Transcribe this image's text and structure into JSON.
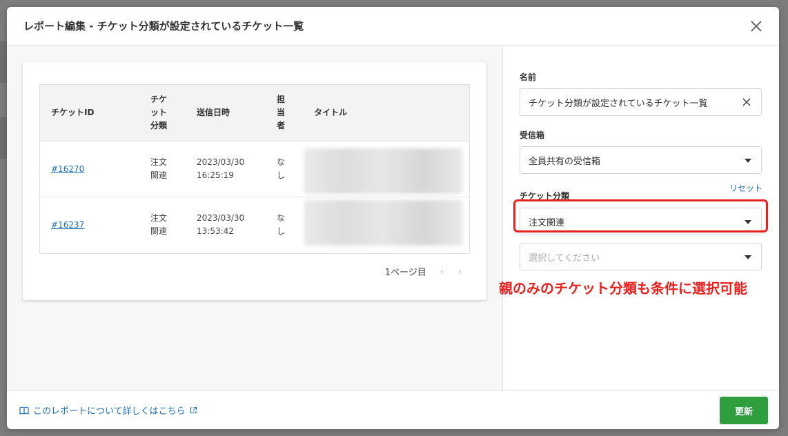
{
  "modal": {
    "title": "レポート編集 - チケット分類が設定されているチケット一覧"
  },
  "table": {
    "headers": {
      "ticket_id": "チケットID",
      "category": [
        "チケ",
        "ット",
        "分類"
      ],
      "sent_at": "送信日時",
      "assignee": [
        "担",
        "当",
        "者"
      ],
      "title": "タイトル"
    },
    "rows": [
      {
        "id": "#16270",
        "category": [
          "注文",
          "関連"
        ],
        "date": "2023/03/30",
        "time": "16:25:19",
        "assignee": [
          "な",
          "し"
        ]
      },
      {
        "id": "#16237",
        "category": [
          "注文",
          "関連"
        ],
        "date": "2023/03/30",
        "time": "13:53:42",
        "assignee": [
          "な",
          "し"
        ]
      }
    ]
  },
  "pager": {
    "label": "1ページ目",
    "prev_icon": "chevron-left-icon",
    "next_icon": "chevron-right-icon"
  },
  "form": {
    "name_label": "名前",
    "name_value": "チケット分類が設定されているチケット一覧",
    "inbox_label": "受信箱",
    "inbox_value": "全員共有の受信箱",
    "category_label": "チケット分類",
    "reset_label": "リセット",
    "category_value": "注文関連",
    "subcategory_placeholder": "選択してください"
  },
  "annotation": {
    "text": "親のみのチケット分類も条件に選択可能",
    "color": "#e8211e"
  },
  "footer": {
    "help_link": "このレポートについて詳しくはこちら",
    "update_button": "更新"
  },
  "colors": {
    "link": "#1f6fb5",
    "primary_button": "#2e9e3e",
    "highlight_border": "#e8211e"
  }
}
